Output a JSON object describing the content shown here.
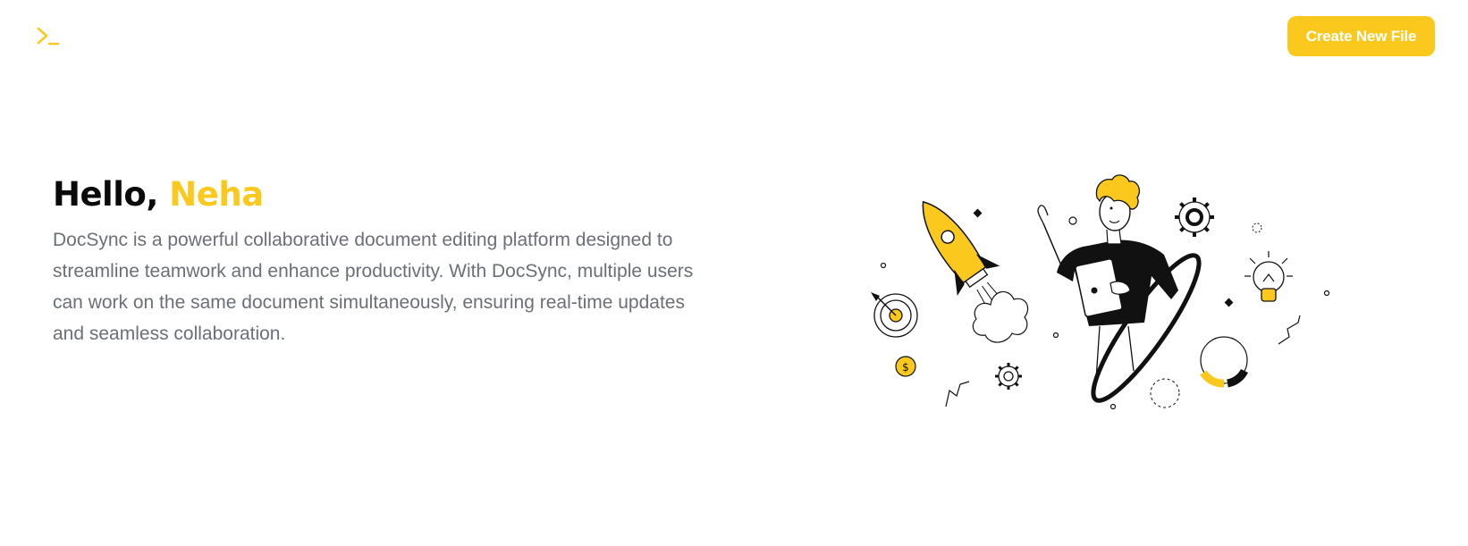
{
  "header": {
    "logo_icon": "terminal-prompt-icon",
    "create_button_label": "Create New File"
  },
  "hero": {
    "greeting_prefix": "Hello, ",
    "user_name": "Neha",
    "description": "DocSync is a powerful collaborative document editing platform designed to streamline teamwork and enhance productivity. With DocSync, multiple users can work on the same document simultaneously, ensuring real-time updates and seamless collaboration."
  },
  "illustration": {
    "icon": "person-launching-rocket-illustration"
  },
  "colors": {
    "accent": "#fbc91d",
    "heading": "#0a0a0a",
    "body_text": "#6b6f76",
    "background": "#ffffff"
  }
}
